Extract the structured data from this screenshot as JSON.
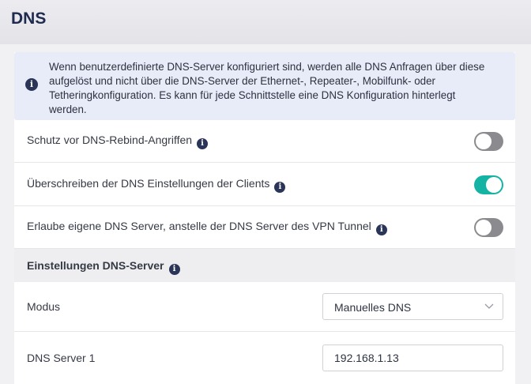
{
  "header": {
    "title": "DNS"
  },
  "info": {
    "text": "Wenn benutzerdefinierte DNS-Server konfiguriert sind, werden alle DNS Anfragen über diese aufgelöst und nicht über die DNS-Server der Ethernet-, Repeater-, Mobilfunk- oder Tetheringkonfiguration. Es kann für jede Schnittstelle eine DNS Konfiguration hinterlegt werden."
  },
  "settings": [
    {
      "label": "Schutz vor DNS-Rebind-Angriffen",
      "enabled": false
    },
    {
      "label": "Überschreiben der DNS Einstellungen der Clients",
      "enabled": true
    },
    {
      "label": "Erlaube eigene DNS Server, anstelle der DNS Server des VPN Tunnel",
      "enabled": false
    }
  ],
  "dns_section": {
    "title": "Einstellungen DNS-Server",
    "mode": {
      "label": "Modus",
      "value": "Manuelles DNS"
    },
    "server1": {
      "label": "DNS Server 1",
      "value": "192.168.1.13"
    }
  },
  "colors": {
    "toggle_on": "#14b3a3",
    "toggle_off": "#8b8b8f",
    "info_bg": "#e8ebf8",
    "title": "#1e2a4f"
  },
  "icons": {
    "info": "info-circle-icon",
    "select_arrow": "chevron-down-icon"
  }
}
